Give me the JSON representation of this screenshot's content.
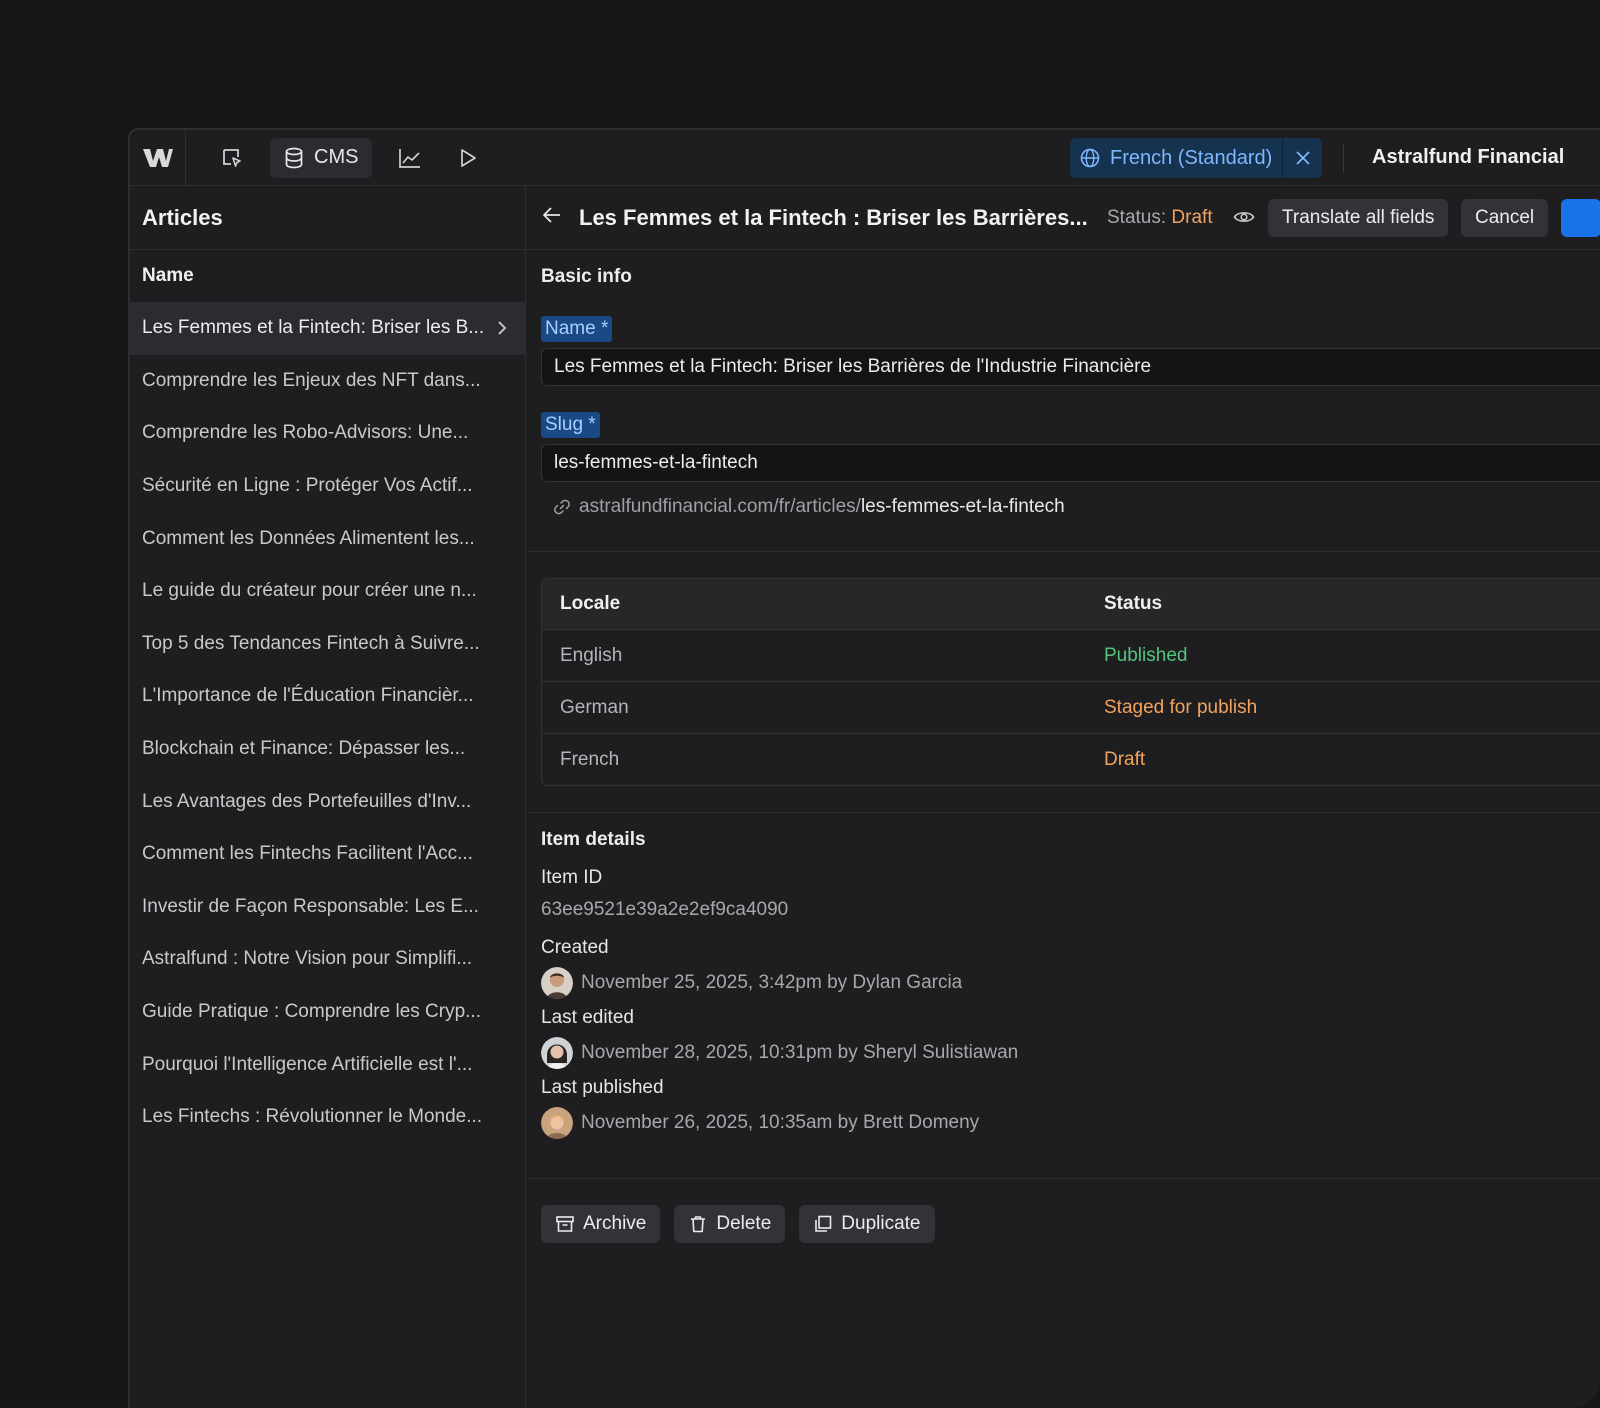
{
  "topbar": {
    "cms_label": "CMS",
    "locale_label": "French (Standard)",
    "site_name": "Astralfund Financial"
  },
  "sidebar": {
    "title": "Articles",
    "column_header": "Name",
    "items": [
      {
        "label": "Les Femmes et la Fintech: Briser les B..."
      },
      {
        "label": "Comprendre les Enjeux des NFT dans..."
      },
      {
        "label": "Comprendre les Robo-Advisors: Une..."
      },
      {
        "label": "Sécurité en Ligne : Protéger Vos Actif..."
      },
      {
        "label": "Comment les Données Alimentent les..."
      },
      {
        "label": "Le guide du créateur pour créer une n..."
      },
      {
        "label": "Top 5 des Tendances Fintech à Suivre..."
      },
      {
        "label": "L'Importance de l'Éducation Financièr..."
      },
      {
        "label": "Blockchain et Finance: Dépasser les..."
      },
      {
        "label": "Les Avantages des Portefeuilles d'Inv..."
      },
      {
        "label": "Comment les Fintechs Facilitent l'Acc..."
      },
      {
        "label": "Investir de Façon Responsable: Les E..."
      },
      {
        "label": "Astralfund : Notre Vision pour Simplifi..."
      },
      {
        "label": "Guide Pratique : Comprendre les Cryp..."
      },
      {
        "label": "Pourquoi l'Intelligence Artificielle est l'..."
      },
      {
        "label": "Les Fintechs : Révolutionner le Monde..."
      }
    ]
  },
  "header": {
    "title": "Les Femmes et la Fintech : Briser les Barrières...",
    "status_prefix": "Status: ",
    "status_value": "Draft",
    "translate_label": "Translate all fields",
    "cancel_label": "Cancel"
  },
  "basic_info": {
    "title": "Basic info",
    "name_label": "Name *",
    "name_value": "Les Femmes et la Fintech: Briser les Barrières de l'Industrie Financière",
    "slug_label": "Slug *",
    "slug_value": "les-femmes-et-la-fintech",
    "url_base": "astralfundfinancial.com/fr/articles/",
    "url_path": "les-femmes-et-la-fintech"
  },
  "locale_table": {
    "headers": [
      "Locale",
      "Status"
    ],
    "rows": [
      {
        "locale": "English",
        "status": "Published"
      },
      {
        "locale": "German",
        "status": "Staged for publish"
      },
      {
        "locale": "French",
        "status": "Draft"
      }
    ]
  },
  "item_details": {
    "title": "Item details",
    "id_label": "Item ID",
    "id_value": "63ee9521e39a2e2ef9ca4090",
    "created_label": "Created",
    "created_value": "November 25, 2025, 3:42pm by Dylan Garcia",
    "edited_label": "Last edited",
    "edited_value": "November 28, 2025, 10:31pm by Sheryl Sulistiawan",
    "published_label": "Last published",
    "published_value": "November 26, 2025, 10:35am by Brett Domeny"
  },
  "actions": {
    "archive": "Archive",
    "delete": "Delete",
    "duplicate": "Duplicate"
  },
  "colors": {
    "accent_blue": "#1a73e8",
    "published": "#54c47d",
    "draft": "#f0a35e"
  }
}
